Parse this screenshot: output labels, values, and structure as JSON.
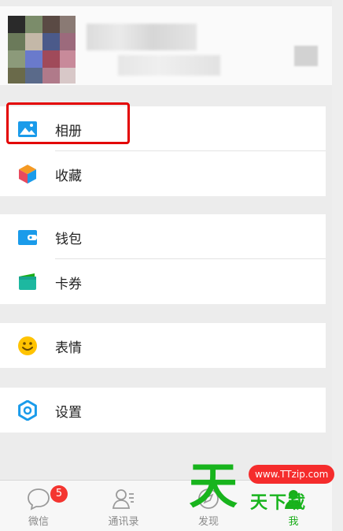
{
  "menu": {
    "groups": [
      [
        {
          "label": "相册",
          "icon": "album-icon"
        },
        {
          "label": "收藏",
          "icon": "favorites-cube-icon"
        }
      ],
      [
        {
          "label": "钱包",
          "icon": "wallet-icon"
        },
        {
          "label": "卡券",
          "icon": "card-coupon-icon"
        }
      ],
      [
        {
          "label": "表情",
          "icon": "emoji-smile-icon"
        }
      ],
      [
        {
          "label": "设置",
          "icon": "settings-gear-icon"
        }
      ]
    ]
  },
  "tabbar": {
    "tabs": [
      {
        "label": "微信",
        "icon": "chat-bubble-icon",
        "badge": "5"
      },
      {
        "label": "通讯录",
        "icon": "contacts-icon"
      },
      {
        "label": "发现",
        "icon": "discover-compass-icon"
      },
      {
        "label": "我",
        "icon": "me-person-icon",
        "active": true
      }
    ]
  },
  "watermark": {
    "big": "天",
    "url": "www.TTzip.com",
    "small": "天下载"
  },
  "colors": {
    "accent_green": "#1aad19",
    "badge_red": "#f43530",
    "highlight_red": "#e30000",
    "icon_blue": "#1a9bea"
  }
}
